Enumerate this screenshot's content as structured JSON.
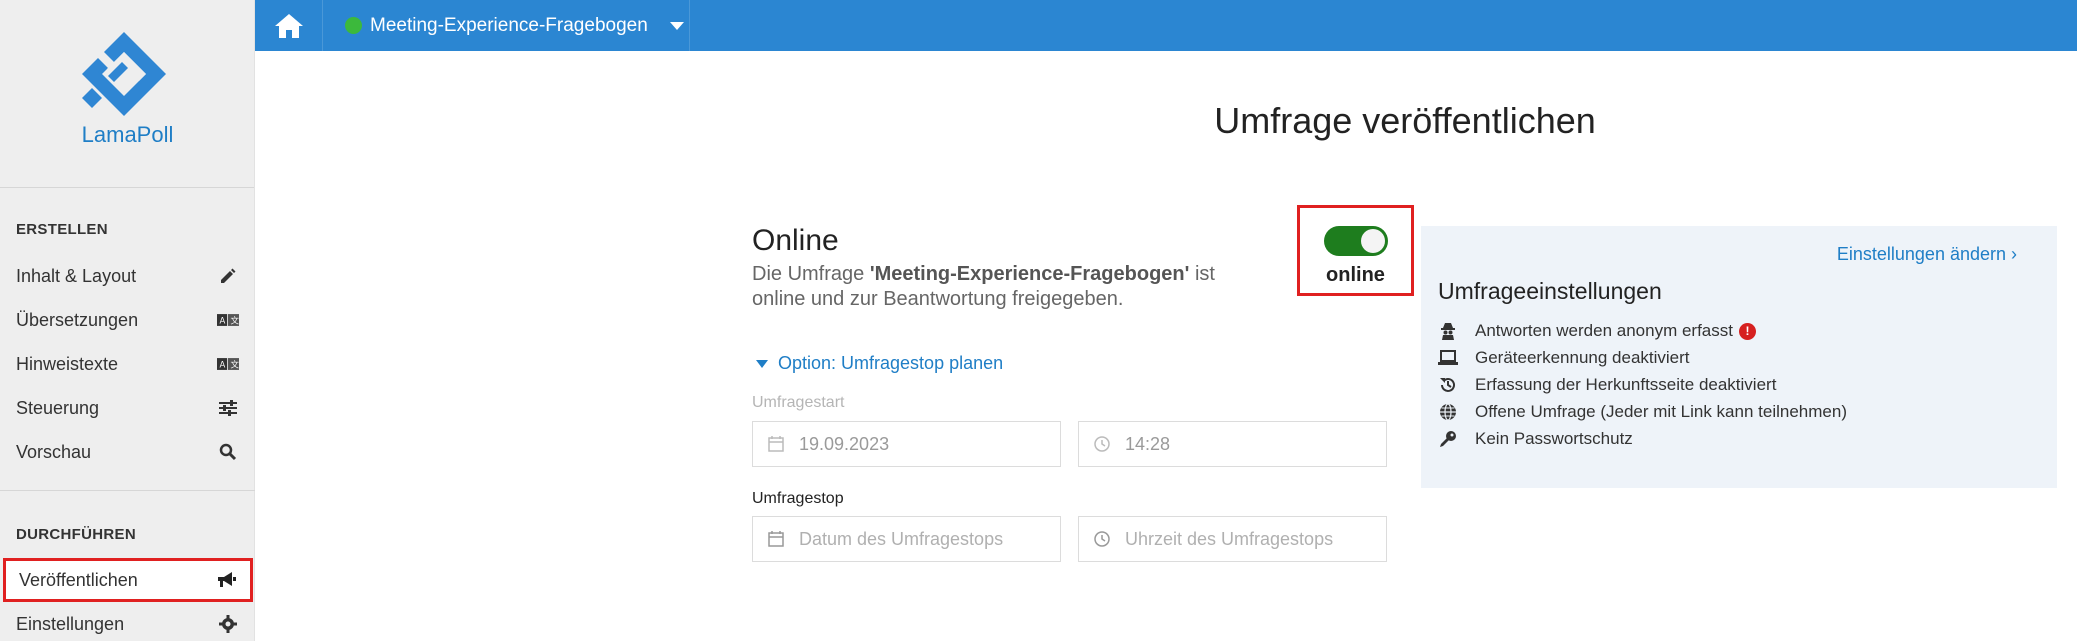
{
  "app": {
    "logo_text": "LamaPoll"
  },
  "topbar": {
    "survey_name": "Meeting-Experience-Fragebogen",
    "status_color": "#3cb93c"
  },
  "sidebar": {
    "section_create": "ERSTELLEN",
    "create_items": [
      {
        "label": "Inhalt & Layout",
        "icon": "pencil-icon"
      },
      {
        "label": "Übersetzungen",
        "icon": "translate-icon"
      },
      {
        "label": "Hinweistexte",
        "icon": "translate-icon"
      },
      {
        "label": "Steuerung",
        "icon": "sliders-icon"
      },
      {
        "label": "Vorschau",
        "icon": "search-icon"
      }
    ],
    "section_run": "DURCHFÜHREN",
    "run_items": [
      {
        "label": "Veröffentlichen",
        "icon": "megaphone-icon"
      },
      {
        "label": "Einstellungen",
        "icon": "gear-icon"
      }
    ]
  },
  "main": {
    "page_title": "Umfrage veröffentlichen",
    "status_title": "Online",
    "status_desc_pre": "Die Umfrage ",
    "status_desc_name": "'Meeting-Experience-Fragebogen'",
    "status_desc_post": " ist online und zur Beantwortung freigegeben.",
    "toggle_label": "online",
    "option_link": "Option: Umfragestop planen",
    "start_label": "Umfragestart",
    "start_date": "19.09.2023",
    "start_time": "14:28",
    "stop_label": "Umfragestop",
    "stop_date_placeholder": "Datum des Umfragestops",
    "stop_time_placeholder": "Uhrzeit des Umfragestops"
  },
  "settings_panel": {
    "edit_link": "Einstellungen ändern ›",
    "title": "Umfrageeinstellungen",
    "items": [
      {
        "text": "Antworten werden anonym erfasst",
        "icon": "anonymous-icon",
        "warning": "!"
      },
      {
        "text": "Geräteerkennung deaktiviert",
        "icon": "laptop-icon"
      },
      {
        "text": "Erfassung der Herkunftsseite deaktiviert",
        "icon": "history-icon"
      },
      {
        "text": "Offene Umfrage (Jeder mit Link kann teilnehmen)",
        "icon": "globe-icon"
      },
      {
        "text": "Kein Passwortschutz",
        "icon": "key-icon"
      }
    ]
  },
  "colors": {
    "accent": "#2b86d2",
    "link": "#1f7ec6",
    "toggle_on": "#1e7d1e",
    "highlight": "#e02020",
    "panel_bg": "#eef3f9"
  }
}
